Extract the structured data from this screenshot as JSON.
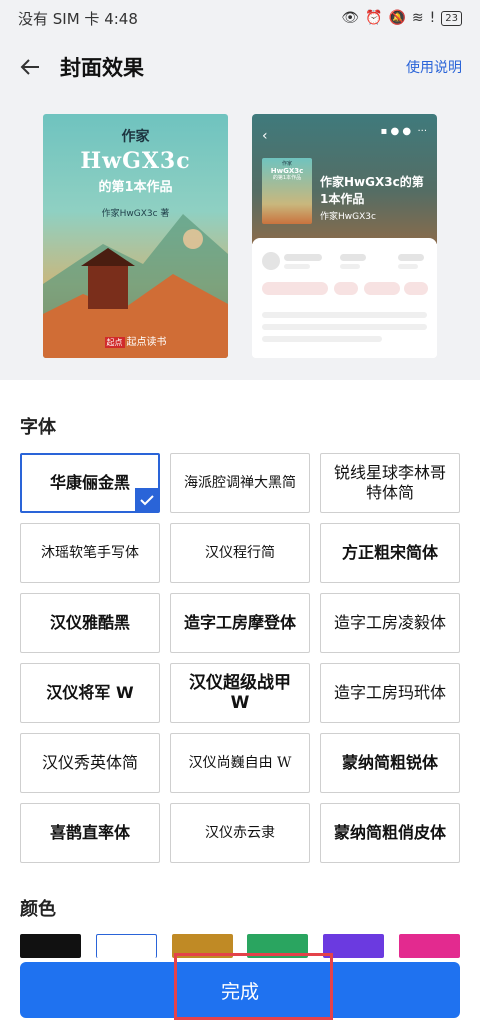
{
  "status_bar": {
    "carrier_time": "没有 SIM 卡 4:48",
    "battery": "23"
  },
  "header": {
    "title": "封面效果",
    "help_link": "使用说明",
    "back_icon": "arrow-left-icon"
  },
  "cover": {
    "author_label": "作家",
    "pen_name": "HwGX3c",
    "subtitle": "的第1本作品",
    "byline": "作家HwGX3c 著",
    "logo_badge": "起点",
    "logo_text": "起点读书"
  },
  "detail_preview": {
    "cover_author": "作家",
    "cover_name": "HwGX3c",
    "cover_sub": "的第1本作品",
    "title": "作家HwGX3c的第1本作品",
    "author": "作家HwGX3c"
  },
  "fonts": {
    "label": "字体",
    "items": [
      {
        "name": "华康俪金黑",
        "selected": true
      },
      {
        "name": "海派腔调禅大黑简"
      },
      {
        "name": "锐线星球李林哥特体简"
      },
      {
        "name": "沐瑶软笔手写体"
      },
      {
        "name": "汉仪程行简"
      },
      {
        "name": "方正粗宋简体"
      },
      {
        "name": "汉仪雅酷黑"
      },
      {
        "name": "造字工房摩登体"
      },
      {
        "name": "造字工房凌毅体"
      },
      {
        "name": "汉仪将军 W"
      },
      {
        "name": "汉仪超级战甲 W"
      },
      {
        "name": "造字工房玛玳体"
      },
      {
        "name": "汉仪秀英体简"
      },
      {
        "name": "汉仪尚巍自由 W"
      },
      {
        "name": "蒙纳简粗锐体"
      },
      {
        "name": "喜鹊直率体"
      },
      {
        "name": "汉仪赤云隶"
      },
      {
        "name": "蒙纳简粗俏皮体"
      }
    ]
  },
  "colors": {
    "label": "颜色",
    "swatches": [
      "#111111",
      "#ffffff",
      "#c08a25",
      "#2aa560",
      "#6b3ae0",
      "#e32a8f"
    ],
    "selected_index": 1
  },
  "done_button": "完成",
  "accent_color": "#2a64d8"
}
